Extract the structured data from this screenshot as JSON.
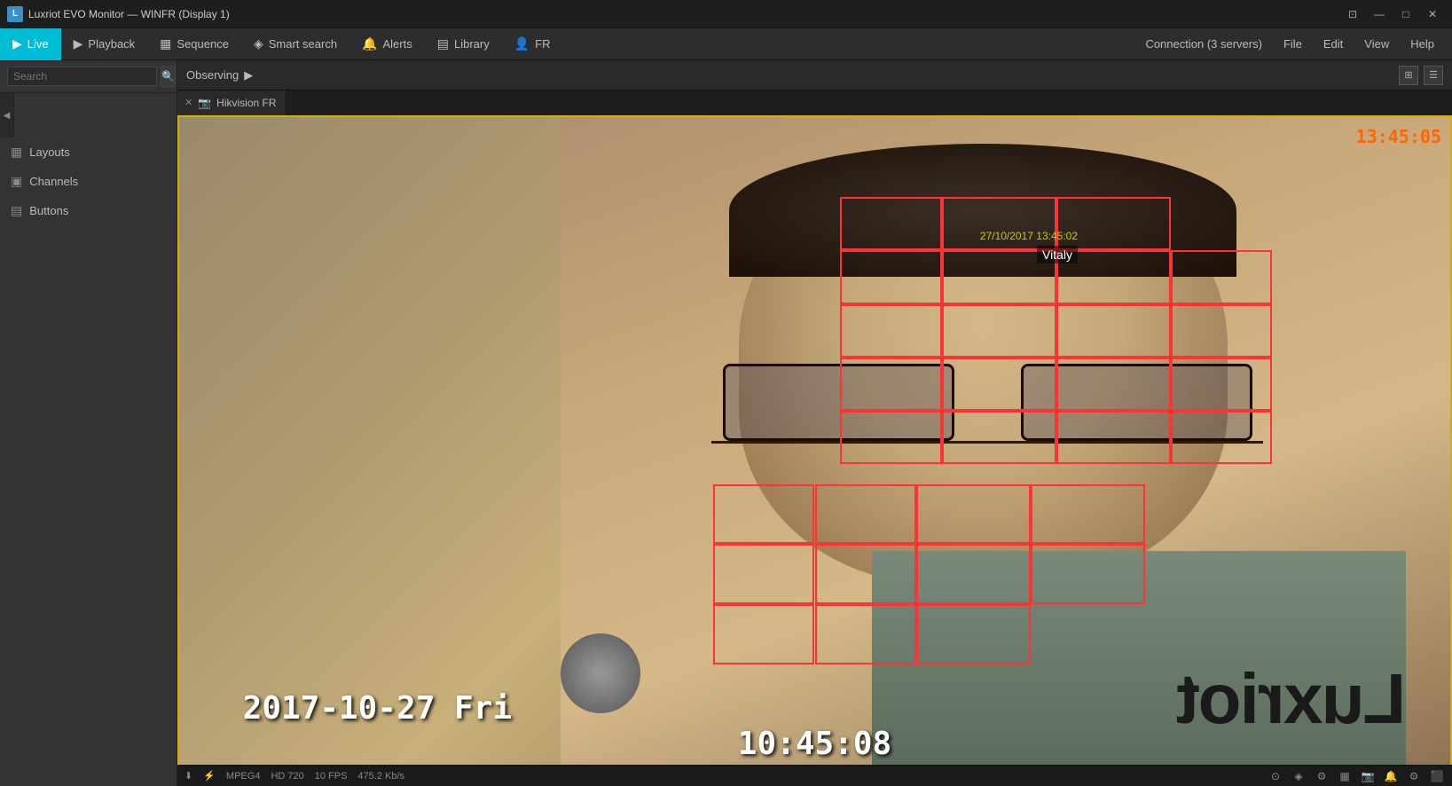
{
  "titlebar": {
    "title": "Luxriot EVO Monitor — WINFR (Display 1)",
    "app_icon": "L",
    "controls": {
      "restore": "⊡",
      "minimize": "—",
      "maximize": "□",
      "close": "✕"
    }
  },
  "nav": {
    "tabs": [
      {
        "id": "live",
        "label": "Live",
        "icon": "▶",
        "active": true
      },
      {
        "id": "playback",
        "label": "Playback",
        "icon": "▶"
      },
      {
        "id": "sequence",
        "label": "Sequence",
        "icon": "▦"
      },
      {
        "id": "smart_search",
        "label": "Smart search",
        "icon": "◈"
      },
      {
        "id": "alerts",
        "label": "Alerts",
        "icon": "🔔"
      },
      {
        "id": "library",
        "label": "Library",
        "icon": "▤"
      },
      {
        "id": "fr",
        "label": "FR",
        "icon": "👤"
      }
    ],
    "right_items": [
      {
        "id": "connection",
        "label": "Connection (3 servers)"
      },
      {
        "id": "file",
        "label": "File"
      },
      {
        "id": "edit",
        "label": "Edit"
      },
      {
        "id": "view",
        "label": "View"
      },
      {
        "id": "help",
        "label": "Help"
      }
    ]
  },
  "sidebar": {
    "search_placeholder": "Search",
    "items": [
      {
        "id": "layouts",
        "label": "Layouts",
        "icon": "▦"
      },
      {
        "id": "channels",
        "label": "Channels",
        "icon": "▣"
      },
      {
        "id": "buttons",
        "label": "Buttons",
        "icon": "▤"
      }
    ]
  },
  "observing": {
    "label": "Observing",
    "arrow": "▶"
  },
  "camera_tab": {
    "name": "Hikvision FR",
    "close": "✕"
  },
  "video": {
    "timestamp_top_right": "13:45:05",
    "detection_datetime": "27/10/2017 13:45:02",
    "detection_name": "Vitaly",
    "bottom_date": "2017-10-27  Fri",
    "bottom_time": "10:45:08",
    "shirt_text": "Luxriot"
  },
  "status_bar": {
    "codec": "MPEG4",
    "resolution": "HD 720",
    "fps": "10 FPS",
    "bitrate": "475.2 Kb/s",
    "icons": [
      "⬇",
      "⚡",
      "▦",
      "⊙",
      "◈",
      "📷",
      "🔔",
      "⚙"
    ]
  },
  "colors": {
    "active_tab": "#00bcd4",
    "timestamp_color": "#ff6600",
    "border_yellow": "#d4af00",
    "detection_red": "#ff3333",
    "detection_datetime_color": "#cccc00"
  }
}
